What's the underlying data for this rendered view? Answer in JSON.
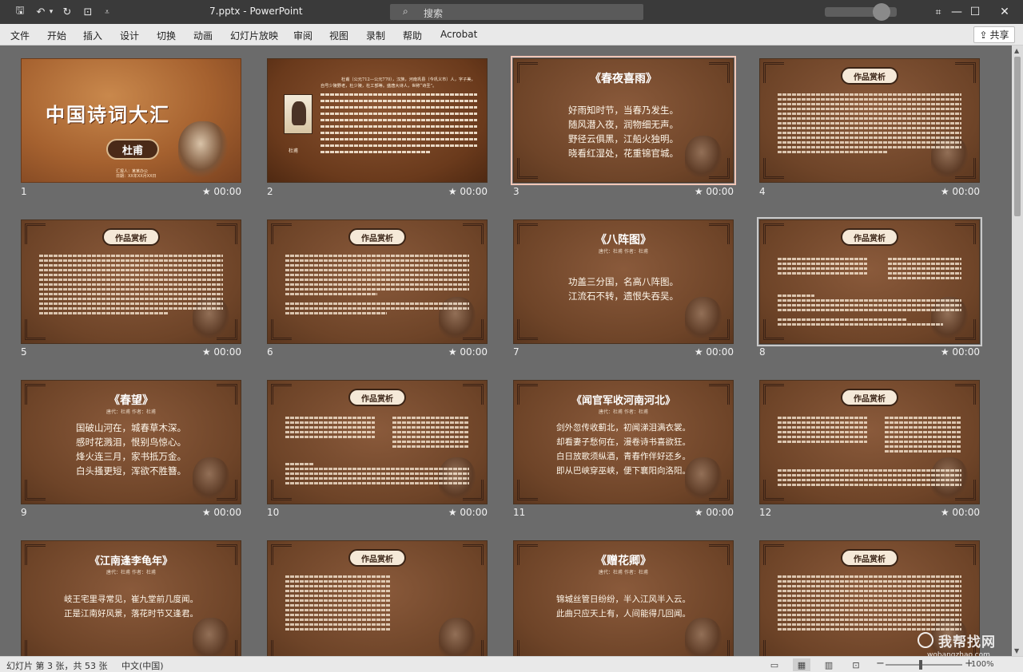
{
  "window": {
    "doc_title": "7.pptx  -  PowerPoint",
    "search_placeholder": "搜索",
    "minimize_icon": "—",
    "maximize_icon": "☐",
    "close_icon": "✕"
  },
  "quick_access": {
    "save_icon": "🖫",
    "undo_icon": "↶",
    "undo_dropdown_icon": "▾",
    "redo_icon": "↻",
    "present_icon": "⊡",
    "customize_icon": "⩡"
  },
  "ribbon": {
    "tabs": [
      "文件",
      "开始",
      "插入",
      "设计",
      "切换",
      "动画",
      "幻灯片放映",
      "审阅",
      "视图",
      "录制",
      "帮助",
      "Acrobat"
    ],
    "share_label": "共享",
    "share_icon": "⇪"
  },
  "slides": [
    {
      "num": "1",
      "time": "★ 00:00",
      "title": "中国诗词大汇",
      "name": "杜甫",
      "meta": [
        "汇报人：某某办公",
        "日期：XX年XX月XX日"
      ]
    },
    {
      "num": "2",
      "time": "★ 00:00",
      "caption": "杜甫",
      "para": "杜甫（公元712—公元770），汉族，河南巩县（今巩义市）人，字子美，自号少陵野老，杜少陵，杜工部等。盛唐大诗人，世称“诗圣”。"
    },
    {
      "num": "3",
      "time": "★ 00:00",
      "title": "《春夜喜雨》",
      "lines": [
        "好雨知时节，当春乃发生。",
        "随风潜入夜，润物细无声。",
        "野径云俱黑，江船火独明。",
        "晓看红湿处，花重锦官城。"
      ]
    },
    {
      "num": "4",
      "time": "★ 00:00",
      "badge": "作品赏析"
    },
    {
      "num": "5",
      "time": "★ 00:00",
      "badge": "作品赏析"
    },
    {
      "num": "6",
      "time": "★ 00:00",
      "badge": "作品赏析"
    },
    {
      "num": "7",
      "time": "★ 00:00",
      "title": "《八阵图》",
      "author": "唐代：杜甫   作者：杜甫",
      "lines": [
        "功盖三分国，名高八阵图。",
        "江流石不转，遗恨失吞吴。"
      ]
    },
    {
      "num": "8",
      "time": "★ 00:00",
      "badge": "作品赏析"
    },
    {
      "num": "9",
      "time": "★ 00:00",
      "title": "《春望》",
      "author": "唐代：杜甫   作者：杜甫",
      "lines": [
        "国破山河在，城春草木深。",
        "感时花溅泪，恨别鸟惊心。",
        "烽火连三月，家书抵万金。",
        "白头搔更短，浑欲不胜簪。"
      ]
    },
    {
      "num": "10",
      "time": "★ 00:00",
      "badge": "作品赏析"
    },
    {
      "num": "11",
      "time": "★ 00:00",
      "title": "《闻官军收河南河北》",
      "author": "唐代：杜甫   作者：杜甫",
      "lines": [
        "剑外忽传收蓟北，初闻涕泪满衣裳。",
        "却看妻子愁何在，漫卷诗书喜欲狂。",
        "白日放歌须纵酒，青春作伴好还乡。",
        "即从巴峡穿巫峡，便下襄阳向洛阳。"
      ]
    },
    {
      "num": "12",
      "time": "★ 00:00",
      "badge": "作品赏析"
    },
    {
      "num": "13",
      "time": "★ 00:00",
      "title": "《江南逢李龟年》",
      "author": "唐代：杜甫   作者：杜甫",
      "lines": [
        "岐王宅里寻常见，崔九堂前几度闻。",
        "正是江南好风景，落花时节又逢君。"
      ]
    },
    {
      "num": "14",
      "time": "★ 00:00",
      "badge": "作品赏析"
    },
    {
      "num": "15",
      "time": "★ 00:00",
      "title": "《赠花卿》",
      "author": "唐代：杜甫   作者：杜甫",
      "lines": [
        "锦城丝管日纷纷，半入江风半入云。",
        "此曲只应天上有，人间能得几回闻。"
      ]
    },
    {
      "num": "16",
      "time": "★ 00:00",
      "badge": "作品赏析"
    }
  ],
  "status": {
    "slide_info": "幻灯片 第 3 张，共 53 张",
    "language": "中文(中国)",
    "view_icons": [
      "▭",
      "▦",
      "▥",
      "⊡"
    ],
    "zoom_minus": "−",
    "zoom_plus": "+",
    "zoom_pct": "100%"
  },
  "watermark": {
    "main": "我帮找网",
    "url": "wobangzhao.com"
  }
}
